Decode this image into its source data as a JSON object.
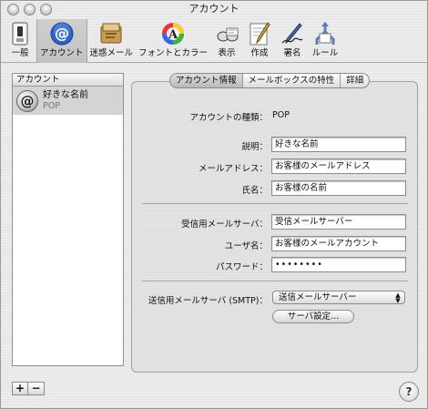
{
  "window": {
    "title": "アカウント"
  },
  "toolbar": {
    "items": [
      {
        "label": "一般",
        "icon": "switch-icon"
      },
      {
        "label": "アカウント",
        "icon": "at-sign-icon"
      },
      {
        "label": "迷惑メール",
        "icon": "junk-mail-icon"
      },
      {
        "label": "フォントとカラー",
        "icon": "fonts-colors-icon"
      },
      {
        "label": "表示",
        "icon": "viewing-icon"
      },
      {
        "label": "作成",
        "icon": "compose-icon"
      },
      {
        "label": "署名",
        "icon": "signature-icon"
      },
      {
        "label": "ルール",
        "icon": "rules-icon"
      }
    ],
    "selected": "アカウント"
  },
  "accounts": {
    "header": "アカウント",
    "items": [
      {
        "name": "好きな名前",
        "type": "POP"
      }
    ]
  },
  "buttons": {
    "add": "+",
    "remove": "−",
    "help": "?"
  },
  "tabs": [
    "アカウント情報",
    "メールボックスの特性",
    "詳細"
  ],
  "account_info": {
    "type_label": "アカウントの種類：",
    "type_value": "POP",
    "description_label": "説明：",
    "description_value": "好きな名前",
    "email_label": "メールアドレス：",
    "email_value": "お客様のメールアドレス",
    "fullname_label": "氏名：",
    "fullname_value": "お客様の名前",
    "incoming_label": "受信用メールサーバ：",
    "incoming_value": "受信メールサーバー",
    "username_label": "ユーザ名：",
    "username_value": "お客様のメールアカウント",
    "password_label": "パスワード：",
    "password_value": "••••••••",
    "smtp_label": "送信用メールサーバ (SMTP)：",
    "smtp_value": "送信メールサーバー",
    "server_settings_button": "サーバ設定..."
  }
}
